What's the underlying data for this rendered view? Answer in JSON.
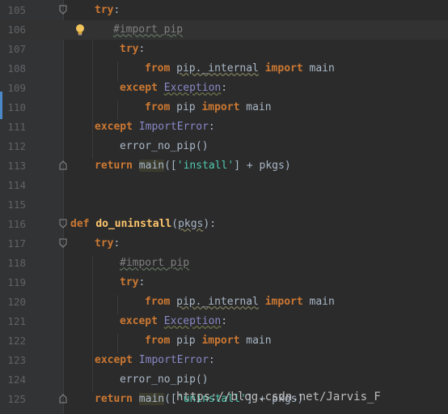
{
  "lines": [
    {
      "n": "105"
    },
    {
      "n": "106"
    },
    {
      "n": "107"
    },
    {
      "n": "108"
    },
    {
      "n": "109"
    },
    {
      "n": "110"
    },
    {
      "n": "111"
    },
    {
      "n": "112"
    },
    {
      "n": "113"
    },
    {
      "n": "114"
    },
    {
      "n": "115"
    },
    {
      "n": "116"
    },
    {
      "n": "117"
    },
    {
      "n": "118"
    },
    {
      "n": "119"
    },
    {
      "n": "120"
    },
    {
      "n": "121"
    },
    {
      "n": "122"
    },
    {
      "n": "123"
    },
    {
      "n": "124"
    },
    {
      "n": "125"
    }
  ],
  "code": {
    "try": "try",
    "colon": ":",
    "hash_import_pip": "#import pip",
    "from": "from",
    "pip_internal": "pip._internal",
    "import": "import",
    "main": "main",
    "except": "except",
    "Exception": "Exception",
    "ImportError": "ImportError",
    "error_no_pip": "error_no_pip()",
    "return": "return",
    "main_call_open": "([",
    "install_str": "'install'",
    "uninstall_str": "'uninstall'",
    "close_pkgs": "] + pkgs)",
    "pip": "pip",
    "def": "def",
    "do_uninstall": "do_uninstall",
    "pkgs": "pkgs",
    "paren_open": "(",
    "paren_close_colon": "):"
  },
  "watermark": "https://blog.csdn.net/Jarvis_F",
  "icons": {
    "bulb": "lightbulb-icon",
    "fold": "fold-marker-icon"
  },
  "colors": {
    "keyword": "#cc7832",
    "function": "#ffc66d",
    "builtin": "#8888c6",
    "string": "#4ec9b0",
    "comment": "#808080"
  }
}
